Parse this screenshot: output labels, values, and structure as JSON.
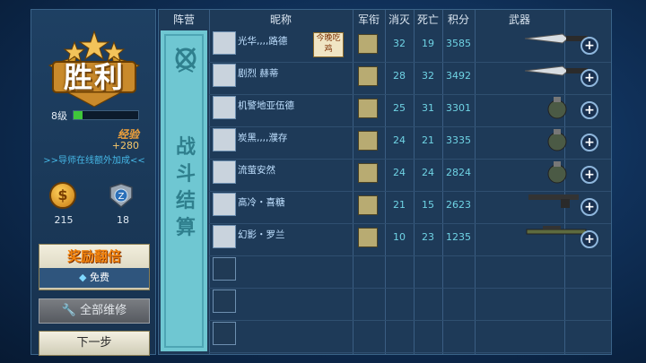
{
  "left": {
    "victory": "胜利",
    "level": "8级",
    "xp_fraction": 0.14,
    "exp_label": "经验",
    "exp_value": "+280",
    "mentor_bonus": ">>导师在线额外加成<<",
    "coin_count": "215",
    "badge_count": "18",
    "double_reward": {
      "title": "奖励翻倍",
      "sub": "免费"
    },
    "repair_all": "全部维修",
    "next_step": "下一步"
  },
  "board": {
    "headers": {
      "camp": "阵营",
      "nickname": "昵称",
      "rank": "军衔",
      "kills": "消灭",
      "deaths": "死亡",
      "score": "积分",
      "weapon": "武器"
    },
    "side_label": "战斗结算",
    "rows": [
      {
        "name": "光华,,,,路德",
        "kills": "32",
        "deaths": "19",
        "score": "3585",
        "weapon": "knife",
        "extra": "今晚吃鸡"
      },
      {
        "name": "剧烈 赫蒂",
        "kills": "28",
        "deaths": "32",
        "score": "3492",
        "weapon": "knife"
      },
      {
        "name": "机警地亚伍德",
        "kills": "25",
        "deaths": "31",
        "score": "3301",
        "weapon": "grenade"
      },
      {
        "name": "炭黑,,,,濮存",
        "kills": "24",
        "deaths": "21",
        "score": "3335",
        "weapon": "grenade"
      },
      {
        "name": "流萤安然",
        "kills": "24",
        "deaths": "24",
        "score": "2824",
        "weapon": "grenade"
      },
      {
        "name": "高冷・喜糖",
        "kills": "21",
        "deaths": "15",
        "score": "2623",
        "weapon": "pistol"
      },
      {
        "name": "幻影・罗兰",
        "kills": "10",
        "deaths": "23",
        "score": "1235",
        "weapon": "rifle"
      }
    ],
    "empty_rows": 3
  },
  "colors": {
    "accent": "#6fd3e4",
    "gold": "#f3850f"
  }
}
